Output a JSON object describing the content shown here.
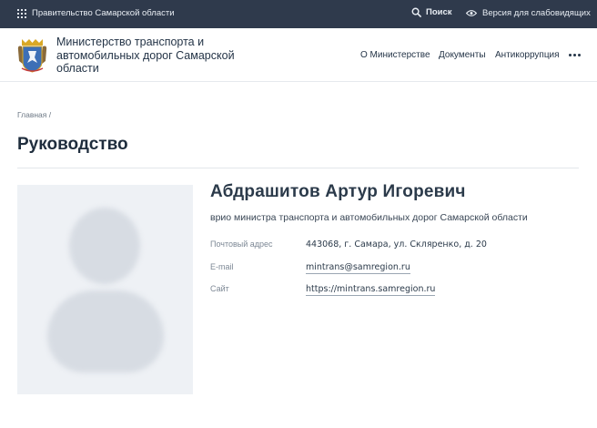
{
  "topbar": {
    "government": "Правительство Самарской области",
    "search": "Поиск",
    "accessibility": "Версия для слабовидящих"
  },
  "header": {
    "ministry_name": "Министерство транспорта и автомобильных дорог Самарской области",
    "nav": [
      "О Министерстве",
      "Документы",
      "Антикоррупция"
    ]
  },
  "breadcrumb": "Главная /",
  "page_title": "Руководство",
  "person": {
    "name": "Абдрашитов Артур Игоревич",
    "position": "врио министра транспорта и автомобильных дорог Самарской области",
    "details": [
      {
        "label": "Почтовый адрес",
        "value": "443068, г. Самара, ул. Скляренко, д. 20"
      },
      {
        "label": "E-mail",
        "value": "mintrans@samregion.ru"
      },
      {
        "label": "Сайт",
        "value": "https://mintrans.samregion.ru"
      }
    ]
  },
  "colors": {
    "topbar": "#2f3a4c",
    "text": "#2b3a4a",
    "emblem_blue": "#3d6fb6",
    "emblem_gold": "#d9a826"
  }
}
